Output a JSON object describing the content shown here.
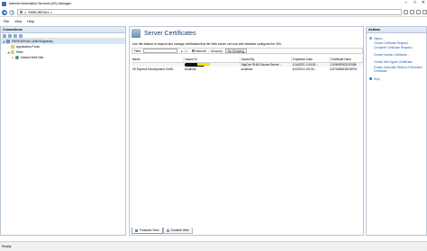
{
  "window": {
    "title": "Internet Information Services (IIS) Manager",
    "controls": {
      "minimize": "–",
      "maximize": "□",
      "close": "✕"
    }
  },
  "address": {
    "segments": [
      "PARKJEEVA1"
    ]
  },
  "menu": [
    "File",
    "View",
    "Help"
  ],
  "connections": {
    "header": "Connections",
    "tree": [
      {
        "label": "PARKJEEVA1 (ANDI\\Uppena)",
        "level": 0
      },
      {
        "label": "Application Pools",
        "level": 1
      },
      {
        "label": "Sites",
        "level": 1
      },
      {
        "label": "Default Web Site",
        "level": 2
      }
    ]
  },
  "features": {
    "title": "Server Certificates",
    "description": "Use this feature to request and manage certificates that the Web server can use with websites configured for SSL.",
    "filter": {
      "label": "Filter:",
      "go": "Go",
      "show_all": "Show All",
      "group_by": "Group by:",
      "group_value": "No Grouping"
    },
    "table": {
      "columns": [
        "Name",
        "Issued To",
        "Issued By",
        "Expiration Date",
        "Certificate Hash"
      ],
      "rows": [
        {
          "name": "",
          "issued_to": "",
          "issued_by": "DigiCert SHA2 Secure Server ...",
          "expiration": "1/14/2021 1:00:00 ...",
          "hash": "C4FA05F8CD1F508"
        },
        {
          "name": "IIS Express Development Certif...",
          "issued_to": "localhost",
          "issued_by": "localhost",
          "expiration": "4/2/2024 1:00:00 ...",
          "hash": "61F3A5BD3DC6EFA"
        }
      ]
    },
    "tabs": {
      "features_view": "Features View",
      "content_view": "Content View"
    }
  },
  "actions": {
    "header": "Actions",
    "items": [
      {
        "label": "Import...",
        "group": 1
      },
      {
        "label": "Create Certificate Request...",
        "group": 1
      },
      {
        "label": "Complete Certificate Request...",
        "group": 1
      },
      {
        "label": "Create Domain Certificate...",
        "group": 2
      },
      {
        "label": "Create Self-Signed Certificate...",
        "group": 2
      },
      {
        "label": "Enable Automatic Rebind of Renewed Certificate",
        "group": 2
      },
      {
        "label": "Help",
        "group": 3
      }
    ]
  },
  "status": {
    "text": "Ready"
  },
  "colors": {
    "accent": "#1f5fb8",
    "panel_border": "#b9c6d6",
    "header_text": "#1e3e6a"
  }
}
